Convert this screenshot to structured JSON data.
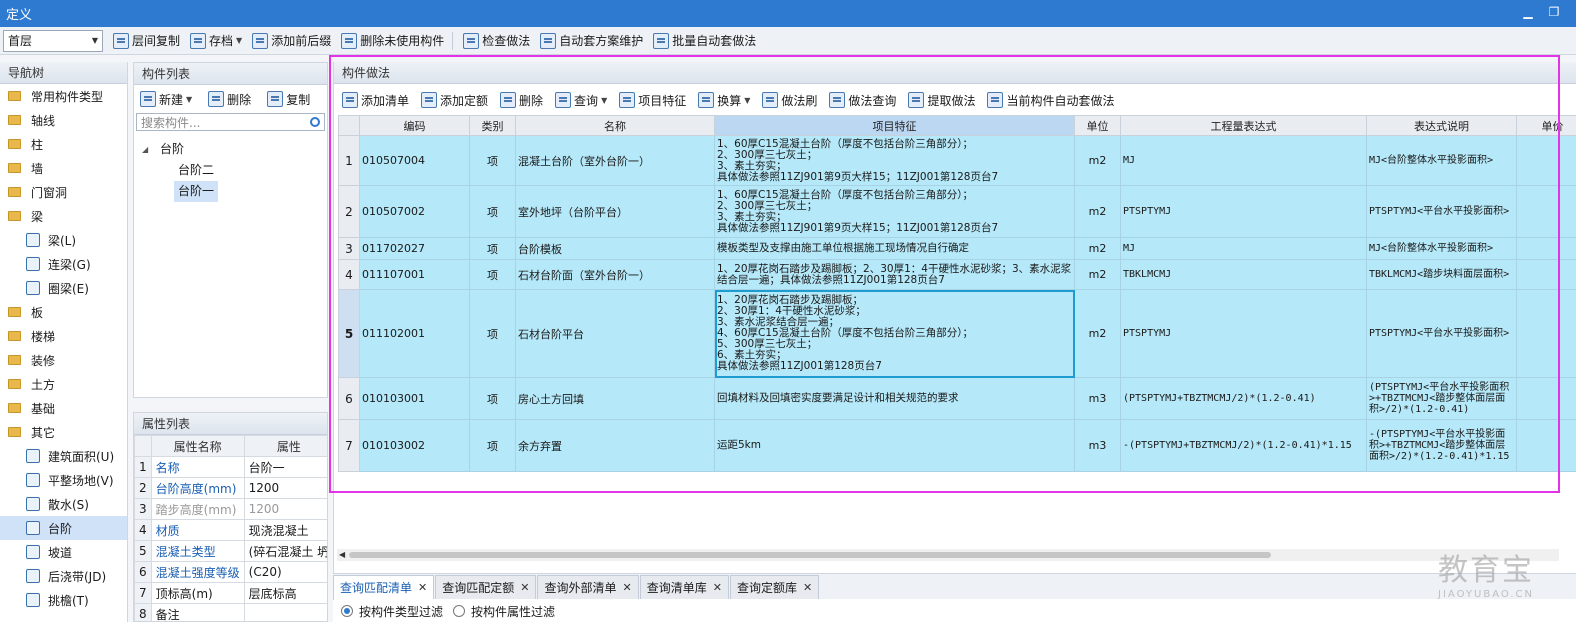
{
  "window": {
    "title": "定义"
  },
  "toolbar": {
    "floor": "首层",
    "buttons": [
      "层间复制",
      "存档",
      "添加前后缀",
      "删除未使用构件",
      "检查做法",
      "自动套方案维护",
      "批量自动套做法"
    ]
  },
  "nav": {
    "title": "导航树",
    "items": [
      {
        "label": "常用构件类型",
        "type": "folder"
      },
      {
        "label": "轴线",
        "type": "folder"
      },
      {
        "label": "柱",
        "type": "folder"
      },
      {
        "label": "墙",
        "type": "folder"
      },
      {
        "label": "门窗洞",
        "type": "folder"
      },
      {
        "label": "梁",
        "type": "folder"
      },
      {
        "label": "梁(L)",
        "type": "child"
      },
      {
        "label": "连梁(G)",
        "type": "child"
      },
      {
        "label": "圈梁(E)",
        "type": "child"
      },
      {
        "label": "板",
        "type": "folder"
      },
      {
        "label": "楼梯",
        "type": "folder"
      },
      {
        "label": "装修",
        "type": "folder"
      },
      {
        "label": "土方",
        "type": "folder"
      },
      {
        "label": "基础",
        "type": "folder"
      },
      {
        "label": "其它",
        "type": "folder"
      },
      {
        "label": "建筑面积(U)",
        "type": "child"
      },
      {
        "label": "平整场地(V)",
        "type": "child"
      },
      {
        "label": "散水(S)",
        "type": "child"
      },
      {
        "label": "台阶",
        "type": "child",
        "selected": true
      },
      {
        "label": "坡道",
        "type": "child"
      },
      {
        "label": "后浇带(JD)",
        "type": "child"
      },
      {
        "label": "挑檐(T)",
        "type": "child"
      }
    ]
  },
  "component_list": {
    "title": "构件列表",
    "new_label": "新建",
    "delete_label": "删除",
    "copy_label": "复制",
    "search_placeholder": "搜索构件...",
    "tree_root": "台阶",
    "children": [
      "台阶二",
      "台阶一"
    ],
    "selected": "台阶一"
  },
  "properties": {
    "title": "属性列表",
    "col_name": "属性名称",
    "col_value": "属性",
    "rows": [
      {
        "n": "1",
        "name": "名称",
        "value": "台阶一",
        "style": "blue"
      },
      {
        "n": "2",
        "name": "台阶高度(mm)",
        "value": "1200",
        "style": "blue"
      },
      {
        "n": "3",
        "name": "踏步高度(mm)",
        "value": "1200",
        "style": "gray"
      },
      {
        "n": "4",
        "name": "材质",
        "value": "现浇混凝土",
        "style": "blue"
      },
      {
        "n": "5",
        "name": "混凝土类型",
        "value": "(碎石混凝土 坍",
        "style": "blue"
      },
      {
        "n": "6",
        "name": "混凝土强度等级",
        "value": "(C20)",
        "style": "blue"
      },
      {
        "n": "7",
        "name": "顶标高(m)",
        "value": "层底标高",
        "style": ""
      },
      {
        "n": "8",
        "name": "备注",
        "value": "",
        "style": ""
      }
    ]
  },
  "methods": {
    "title": "构件做法",
    "toolbar": [
      "添加清单",
      "添加定额",
      "删除",
      "查询",
      "项目特征",
      "换算",
      "做法刷",
      "做法查询",
      "提取做法",
      "当前构件自动套做法"
    ],
    "columns": [
      "编码",
      "类别",
      "名称",
      "项目特征",
      "单位",
      "工程量表达式",
      "表达式说明",
      "单价"
    ],
    "rows": [
      {
        "n": "1",
        "code": "010507004",
        "cat": "项",
        "name": "混凝土台阶（室外台阶一）",
        "feature": "1、60厚C15混凝土台阶（厚度不包括台阶三角部分）；\n2、300厚三七灰土；\n3、素土夯实；\n具体做法参照11ZJ901第9页大样15；11ZJ001第128页台7",
        "unit": "m2",
        "expr": "MJ",
        "desc": "MJ<台阶整体水平投影面积>"
      },
      {
        "n": "2",
        "code": "010507002",
        "cat": "项",
        "name": "室外地坪（台阶平台）",
        "feature": "1、60厚C15混凝土台阶（厚度不包括台阶三角部分）；\n2、300厚三七灰土；\n3、素土夯实；\n具体做法参照11ZJ901第9页大样15；11ZJ001第128页台7",
        "unit": "m2",
        "expr": "PTSPTYMJ",
        "desc": "PTSPTYMJ<平台水平投影面积>"
      },
      {
        "n": "3",
        "code": "011702027",
        "cat": "项",
        "name": "台阶模板",
        "feature": "模板类型及支撑由施工单位根据施工现场情况自行确定",
        "unit": "m2",
        "expr": "MJ",
        "desc": "MJ<台阶整体水平投影面积>"
      },
      {
        "n": "4",
        "code": "011107001",
        "cat": "项",
        "name": "石材台阶面（室外台阶一）",
        "feature": "1、20厚花岗石踏步及踢脚板；2、30厚1：4干硬性水泥砂浆；3、素水泥浆结合层一遍；具体做法参照11ZJ001第128页台7",
        "unit": "m2",
        "expr": "TBKLMCMJ",
        "desc": "TBKLMCMJ<踏步块料面层面积>"
      },
      {
        "n": "5",
        "code": "011102001",
        "cat": "项",
        "name": "石材台阶平台",
        "feature": "1、20厚花岗石踏步及踢脚板；\n2、30厚1：4干硬性水泥砂浆；\n3、素水泥浆结合层一遍；\n4、60厚C15混凝土台阶（厚度不包括台阶三角部分）；\n5、300厚三七灰土；\n6、素土夯实；\n具体做法参照11ZJ001第128页台7",
        "unit": "m2",
        "expr": "PTSPTYMJ",
        "desc": "PTSPTYMJ<平台水平投影面积>"
      },
      {
        "n": "6",
        "code": "010103001",
        "cat": "项",
        "name": "房心土方回填",
        "feature": "回填材料及回填密实度要满足设计和相关规范的要求",
        "unit": "m3",
        "expr": "(PTSPTYMJ+TBZTMCMJ/2)*(1.2-0.41)",
        "desc": "(PTSPTYMJ<平台水平投影面积>+TBZTMCMJ<踏步整体面层面积>/2)*(1.2-0.41)"
      },
      {
        "n": "7",
        "code": "010103002",
        "cat": "项",
        "name": "余方弃置",
        "feature": "运距5km",
        "unit": "m3",
        "expr": "-(PTSPTYMJ+TBZTMCMJ/2)*(1.2-0.41)*1.15",
        "desc": "-(PTSPTYMJ<平台水平投影面积>+TBZTMCMJ<踏步整体面层面积>/2)*(1.2-0.41)*1.15"
      }
    ]
  },
  "bottom_tabs": [
    "查询匹配清单",
    "查询匹配定额",
    "查询外部清单",
    "查询清单库",
    "查询定额库"
  ],
  "filters": [
    "按构件类型过滤",
    "按构件属性过滤"
  ],
  "watermark": {
    "big": "教育宝",
    "small": "JIAOYUBAO.CN"
  },
  "colors": {
    "title_bar": "#2e7ad0",
    "grid_row": "#b5e8f8",
    "highlight": "#e233e8"
  }
}
